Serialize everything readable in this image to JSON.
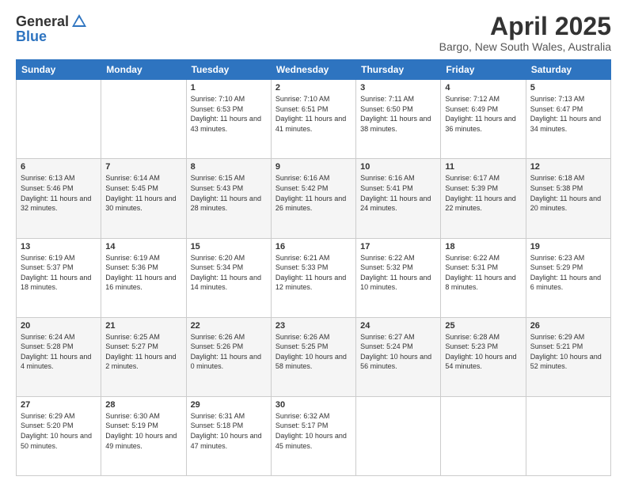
{
  "header": {
    "logo_general": "General",
    "logo_blue": "Blue",
    "title": "April 2025",
    "subtitle": "Bargo, New South Wales, Australia"
  },
  "calendar": {
    "days_of_week": [
      "Sunday",
      "Monday",
      "Tuesday",
      "Wednesday",
      "Thursday",
      "Friday",
      "Saturday"
    ],
    "weeks": [
      [
        {
          "day": "",
          "info": ""
        },
        {
          "day": "",
          "info": ""
        },
        {
          "day": "1",
          "info": "Sunrise: 7:10 AM\nSunset: 6:53 PM\nDaylight: 11 hours and 43 minutes."
        },
        {
          "day": "2",
          "info": "Sunrise: 7:10 AM\nSunset: 6:51 PM\nDaylight: 11 hours and 41 minutes."
        },
        {
          "day": "3",
          "info": "Sunrise: 7:11 AM\nSunset: 6:50 PM\nDaylight: 11 hours and 38 minutes."
        },
        {
          "day": "4",
          "info": "Sunrise: 7:12 AM\nSunset: 6:49 PM\nDaylight: 11 hours and 36 minutes."
        },
        {
          "day": "5",
          "info": "Sunrise: 7:13 AM\nSunset: 6:47 PM\nDaylight: 11 hours and 34 minutes."
        }
      ],
      [
        {
          "day": "6",
          "info": "Sunrise: 6:13 AM\nSunset: 5:46 PM\nDaylight: 11 hours and 32 minutes."
        },
        {
          "day": "7",
          "info": "Sunrise: 6:14 AM\nSunset: 5:45 PM\nDaylight: 11 hours and 30 minutes."
        },
        {
          "day": "8",
          "info": "Sunrise: 6:15 AM\nSunset: 5:43 PM\nDaylight: 11 hours and 28 minutes."
        },
        {
          "day": "9",
          "info": "Sunrise: 6:16 AM\nSunset: 5:42 PM\nDaylight: 11 hours and 26 minutes."
        },
        {
          "day": "10",
          "info": "Sunrise: 6:16 AM\nSunset: 5:41 PM\nDaylight: 11 hours and 24 minutes."
        },
        {
          "day": "11",
          "info": "Sunrise: 6:17 AM\nSunset: 5:39 PM\nDaylight: 11 hours and 22 minutes."
        },
        {
          "day": "12",
          "info": "Sunrise: 6:18 AM\nSunset: 5:38 PM\nDaylight: 11 hours and 20 minutes."
        }
      ],
      [
        {
          "day": "13",
          "info": "Sunrise: 6:19 AM\nSunset: 5:37 PM\nDaylight: 11 hours and 18 minutes."
        },
        {
          "day": "14",
          "info": "Sunrise: 6:19 AM\nSunset: 5:36 PM\nDaylight: 11 hours and 16 minutes."
        },
        {
          "day": "15",
          "info": "Sunrise: 6:20 AM\nSunset: 5:34 PM\nDaylight: 11 hours and 14 minutes."
        },
        {
          "day": "16",
          "info": "Sunrise: 6:21 AM\nSunset: 5:33 PM\nDaylight: 11 hours and 12 minutes."
        },
        {
          "day": "17",
          "info": "Sunrise: 6:22 AM\nSunset: 5:32 PM\nDaylight: 11 hours and 10 minutes."
        },
        {
          "day": "18",
          "info": "Sunrise: 6:22 AM\nSunset: 5:31 PM\nDaylight: 11 hours and 8 minutes."
        },
        {
          "day": "19",
          "info": "Sunrise: 6:23 AM\nSunset: 5:29 PM\nDaylight: 11 hours and 6 minutes."
        }
      ],
      [
        {
          "day": "20",
          "info": "Sunrise: 6:24 AM\nSunset: 5:28 PM\nDaylight: 11 hours and 4 minutes."
        },
        {
          "day": "21",
          "info": "Sunrise: 6:25 AM\nSunset: 5:27 PM\nDaylight: 11 hours and 2 minutes."
        },
        {
          "day": "22",
          "info": "Sunrise: 6:26 AM\nSunset: 5:26 PM\nDaylight: 11 hours and 0 minutes."
        },
        {
          "day": "23",
          "info": "Sunrise: 6:26 AM\nSunset: 5:25 PM\nDaylight: 10 hours and 58 minutes."
        },
        {
          "day": "24",
          "info": "Sunrise: 6:27 AM\nSunset: 5:24 PM\nDaylight: 10 hours and 56 minutes."
        },
        {
          "day": "25",
          "info": "Sunrise: 6:28 AM\nSunset: 5:23 PM\nDaylight: 10 hours and 54 minutes."
        },
        {
          "day": "26",
          "info": "Sunrise: 6:29 AM\nSunset: 5:21 PM\nDaylight: 10 hours and 52 minutes."
        }
      ],
      [
        {
          "day": "27",
          "info": "Sunrise: 6:29 AM\nSunset: 5:20 PM\nDaylight: 10 hours and 50 minutes."
        },
        {
          "day": "28",
          "info": "Sunrise: 6:30 AM\nSunset: 5:19 PM\nDaylight: 10 hours and 49 minutes."
        },
        {
          "day": "29",
          "info": "Sunrise: 6:31 AM\nSunset: 5:18 PM\nDaylight: 10 hours and 47 minutes."
        },
        {
          "day": "30",
          "info": "Sunrise: 6:32 AM\nSunset: 5:17 PM\nDaylight: 10 hours and 45 minutes."
        },
        {
          "day": "",
          "info": ""
        },
        {
          "day": "",
          "info": ""
        },
        {
          "day": "",
          "info": ""
        }
      ]
    ]
  }
}
